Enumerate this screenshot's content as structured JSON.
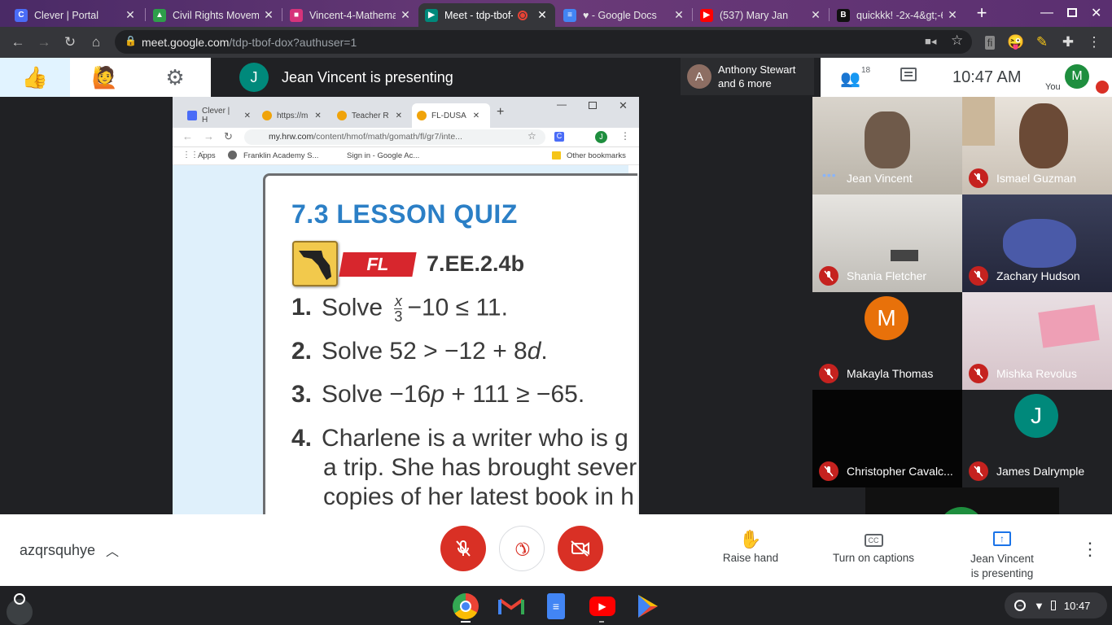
{
  "tabs": [
    {
      "title": "Clever | Portal",
      "fav": "C",
      "color": "#4a6cf7"
    },
    {
      "title": "Civil Rights Movem",
      "fav": "▲",
      "color": "#2e9e4a"
    },
    {
      "title": "Vincent-4-Mathema",
      "fav": "■",
      "color": "#d6337a"
    },
    {
      "title": "Meet - tdp-tbof-",
      "fav": "▶",
      "color": "#00897b"
    },
    {
      "title": "♥ - Google Docs",
      "fav": "≡",
      "color": "#4285f4"
    },
    {
      "title": "(537) Mary Jan",
      "fav": "▶",
      "color": "#ff0000"
    },
    {
      "title": "quickkk! -2x-4&gt;-6",
      "fav": "B",
      "color": "#111111"
    }
  ],
  "url": {
    "host": "meet.google.com",
    "path": "/tdp-tbof-dox?authuser=1"
  },
  "meet": {
    "presenting_banner": "Jean Vincent is presenting",
    "presenter_initial": "J",
    "others_initial": "A",
    "others_line1": "Anthony Stewart",
    "others_line2": "and 6 more",
    "participant_count": "18",
    "time": "10:47  AM",
    "self_initial": "M",
    "self_label": "You",
    "meeting_code": "azqrsquhye",
    "raise_hand": "Raise hand",
    "captions": "Turn on captions",
    "present_line1": "Jean Vincent",
    "present_line2": "is presenting"
  },
  "shared": {
    "tabs": [
      "Clever | H",
      "https://m",
      "Teacher R",
      "FL-DUSA"
    ],
    "url_host": "my.hrw.com",
    "url_path": "/content/hmof/math/gomath/fl/gr7/inte...",
    "bookmarks": [
      "Apps",
      "Franklin Academy S...",
      "Sign in - Google Ac..."
    ],
    "other_bookmarks": "Other bookmarks",
    "quiz_title": "7.3 LESSON QUIZ",
    "badge": "FL",
    "standard": "7.EE.2.4b",
    "q1_num": "1.",
    "q1_a": "Solve",
    "q1_x": "x",
    "q1_3": "3",
    "q1_b": "−10 ≤ 11.",
    "q2_num": "2.",
    "q2": "Solve 52 > −12 + 8",
    "q2_var": "d",
    "q3_num": "3.",
    "q3_a": "Solve −16",
    "q3_var": "p",
    "q3_b": " + 111 ≥ −65.",
    "q4_num": "4.",
    "q4_l1": "Charlene is a writer who is g",
    "q4_l2": "a trip. She has brought sever",
    "q4_l3": "copies of her latest book in h"
  },
  "participants": [
    {
      "name": "Jean Vincent",
      "muted": false
    },
    {
      "name": "Ismael Guzman",
      "muted": true
    },
    {
      "name": "Shania Fletcher",
      "muted": true
    },
    {
      "name": "Zachary Hudson",
      "muted": true
    },
    {
      "name": "Makayla Thomas",
      "muted": true,
      "initial": "M",
      "color": "#e8710a"
    },
    {
      "name": "Mishka Revolus",
      "muted": true
    },
    {
      "name": "Christopher Cavalc...",
      "muted": true
    },
    {
      "name": "James Dalrymple",
      "muted": true,
      "initial": "J",
      "color": "#00897b"
    }
  ],
  "shelf": {
    "time": "10:47"
  }
}
